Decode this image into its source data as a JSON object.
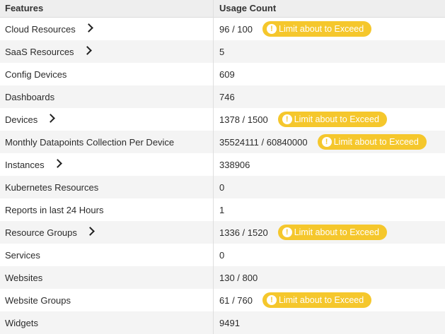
{
  "table": {
    "headers": {
      "features": "Features",
      "usage_count": "Usage Count"
    },
    "badge_label": "Limit about to Exceed",
    "badge_color": "#f5c72c",
    "rows": [
      {
        "feature": "Cloud Resources",
        "usage": "96 / 100",
        "expandable": true,
        "warning": true
      },
      {
        "feature": "SaaS Resources",
        "usage": "5",
        "expandable": true,
        "warning": false
      },
      {
        "feature": "Config Devices",
        "usage": "609",
        "expandable": false,
        "warning": false
      },
      {
        "feature": "Dashboards",
        "usage": "746",
        "expandable": false,
        "warning": false
      },
      {
        "feature": "Devices",
        "usage": "1378 / 1500",
        "expandable": true,
        "warning": true
      },
      {
        "feature": "Monthly Datapoints Collection Per Device",
        "usage": "35524111 / 60840000",
        "expandable": false,
        "warning": true
      },
      {
        "feature": "Instances",
        "usage": "338906",
        "expandable": true,
        "warning": false
      },
      {
        "feature": "Kubernetes Resources",
        "usage": "0",
        "expandable": false,
        "warning": false
      },
      {
        "feature": "Reports in last 24 Hours",
        "usage": "1",
        "expandable": false,
        "warning": false
      },
      {
        "feature": "Resource Groups",
        "usage": "1336 / 1520",
        "expandable": true,
        "warning": true
      },
      {
        "feature": "Services",
        "usage": "0",
        "expandable": false,
        "warning": false
      },
      {
        "feature": "Websites",
        "usage": "130 / 800",
        "expandable": false,
        "warning": false
      },
      {
        "feature": "Website Groups",
        "usage": "61 / 760",
        "expandable": false,
        "warning": true
      },
      {
        "feature": "Widgets",
        "usage": "9491",
        "expandable": false,
        "warning": false
      }
    ]
  }
}
